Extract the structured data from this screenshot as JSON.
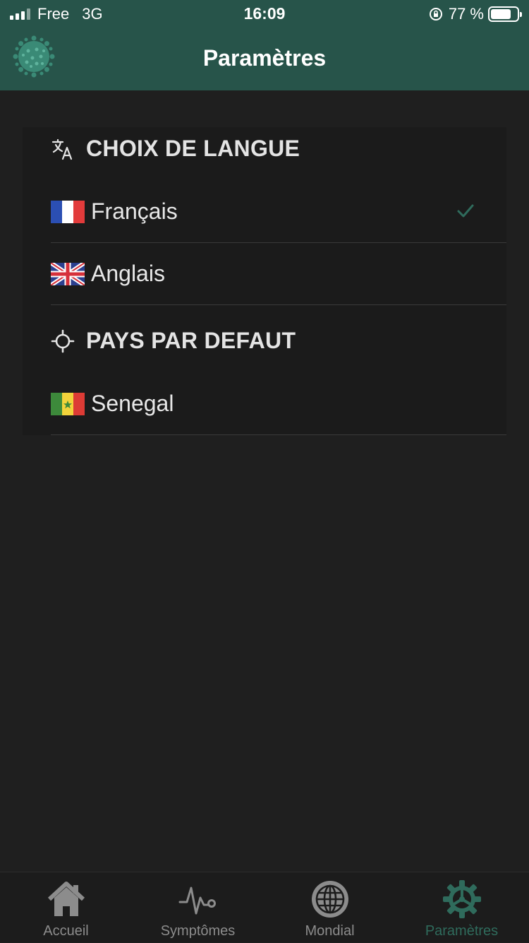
{
  "status_bar": {
    "carrier": "Free",
    "network": "3G",
    "time": "16:09",
    "battery": "77 %",
    "battery_level": 0.77
  },
  "header": {
    "title": "Paramètres",
    "logo_icon": "virus-icon"
  },
  "language_section": {
    "header": "CHOIX DE LANGUE",
    "icon": "translate-icon",
    "options": [
      {
        "label": "Français",
        "flag": "france-flag-icon",
        "selected": true
      },
      {
        "label": "Anglais",
        "flag": "uk-flag-icon",
        "selected": false
      }
    ]
  },
  "country_section": {
    "header": "PAYS PAR DEFAUT",
    "icon": "crosshair-icon",
    "selected_country": {
      "label": "Senegal",
      "flag": "senegal-flag-icon"
    }
  },
  "tab_bar": {
    "items": [
      {
        "label": "Accueil",
        "icon": "home-icon",
        "active": false
      },
      {
        "label": "Symptômes",
        "icon": "pulse-icon",
        "active": false
      },
      {
        "label": "Mondial",
        "icon": "globe-icon",
        "active": false
      },
      {
        "label": "Paramètres",
        "icon": "gear-icon",
        "active": true
      }
    ]
  },
  "colors": {
    "header_bg": "#27544a",
    "accent": "#2f6b5c",
    "background": "#1f1f1f",
    "inactive_tab": "#8c8c8c"
  }
}
